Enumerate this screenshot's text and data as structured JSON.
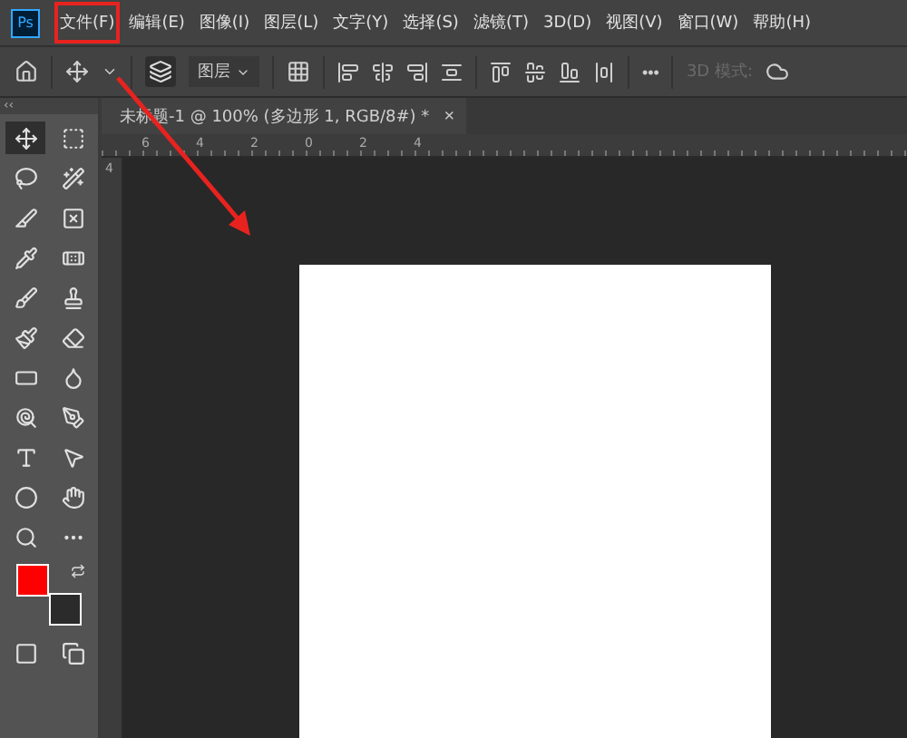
{
  "app_logo": "Ps",
  "menu": [
    {
      "label": "文件(F)",
      "highlighted": true
    },
    {
      "label": "编辑(E)",
      "highlighted": false
    },
    {
      "label": "图像(I)",
      "highlighted": false
    },
    {
      "label": "图层(L)",
      "highlighted": false
    },
    {
      "label": "文字(Y)",
      "highlighted": false
    },
    {
      "label": "选择(S)",
      "highlighted": false
    },
    {
      "label": "滤镜(T)",
      "highlighted": false
    },
    {
      "label": "3D(D)",
      "highlighted": false
    },
    {
      "label": "视图(V)",
      "highlighted": false
    },
    {
      "label": "窗口(W)",
      "highlighted": false
    },
    {
      "label": "帮助(H)",
      "highlighted": false
    }
  ],
  "options_bar": {
    "layer_dropdown": "图层",
    "more": "•••",
    "mode_label": "3D 模式:",
    "mode_disabled": true
  },
  "toolbar": {
    "collapse": "‹‹",
    "tools": [
      {
        "selected": true
      },
      {
        "selected": false
      },
      {
        "selected": false
      },
      {
        "selected": false
      },
      {
        "selected": false
      },
      {
        "selected": false
      },
      {
        "selected": false
      },
      {
        "selected": false
      },
      {
        "selected": false
      },
      {
        "selected": false
      },
      {
        "selected": false
      },
      {
        "selected": false
      },
      {
        "selected": false
      },
      {
        "selected": false
      },
      {
        "selected": false
      },
      {
        "selected": false
      },
      {
        "selected": false
      },
      {
        "selected": false
      },
      {
        "selected": false
      },
      {
        "selected": false
      },
      {
        "selected": false
      },
      {
        "selected": false
      }
    ],
    "swatches": [
      {
        "kind": "foreground",
        "color": "#ff0000"
      },
      {
        "kind": "background",
        "color": "#2b2b2b"
      }
    ]
  },
  "document_tab": {
    "title": "未标题-1 @ 100% (多边形 1, RGB/8#) *",
    "close": "×"
  },
  "ruler": {
    "top_labels": [
      "6",
      "4",
      "2",
      "0",
      "2",
      "4"
    ],
    "left_labels": [
      "4"
    ]
  },
  "annotation_arrow": true
}
